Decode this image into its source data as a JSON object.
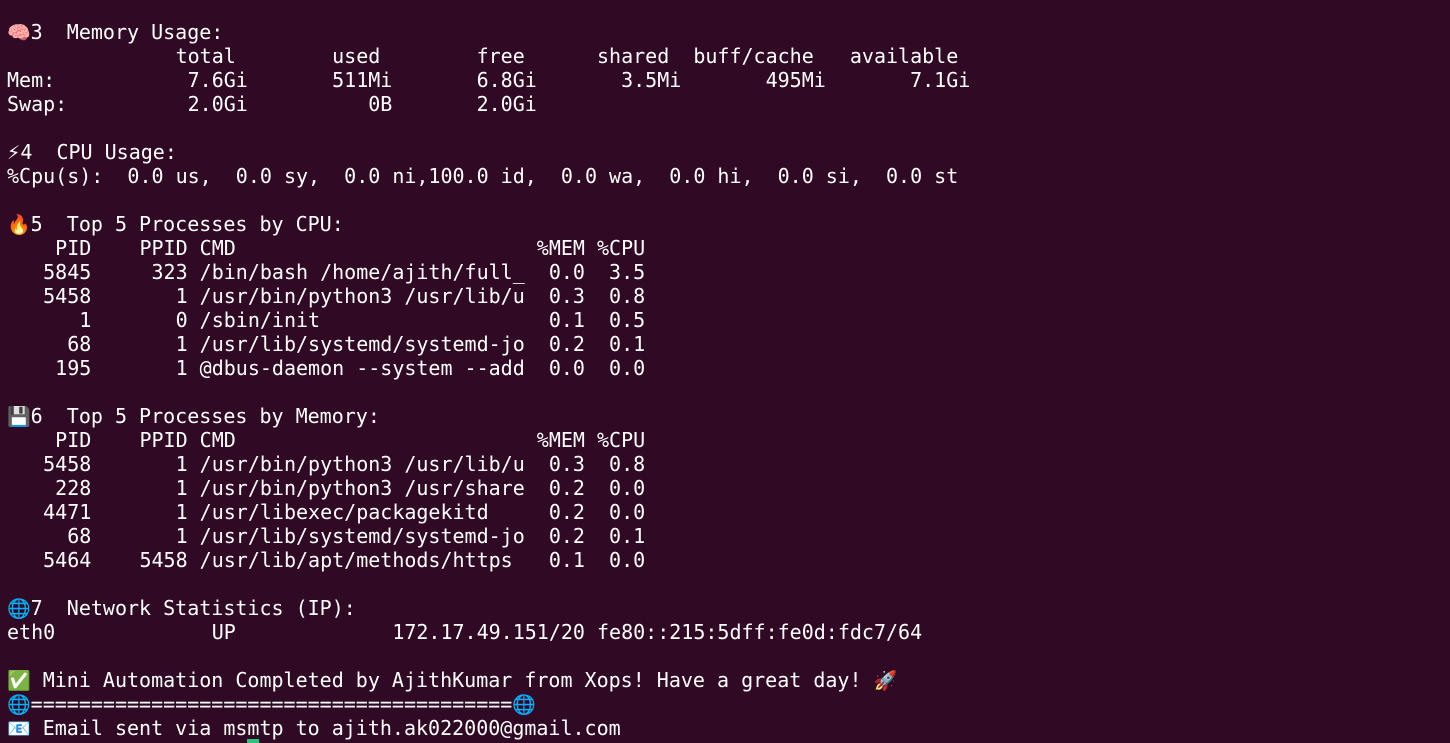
{
  "colors": {
    "background": "#300a24",
    "foreground": "#ffffff",
    "cursor": "#2ec27e"
  },
  "lines": [
    {
      "type": "heading",
      "name": "memory-heading",
      "icon": "brain-icon",
      "glyph": "🧠",
      "text": "3  Memory Usage:"
    },
    {
      "type": "text",
      "name": "memory-table-header",
      "text": "              total        used        free      shared  buff/cache   available"
    },
    {
      "type": "text",
      "name": "memory-row-mem",
      "text": "Mem:           7.6Gi       511Mi       6.8Gi       3.5Mi       495Mi       7.1Gi"
    },
    {
      "type": "text",
      "name": "memory-row-swap",
      "text": "Swap:          2.0Gi          0B       2.0Gi"
    },
    {
      "type": "gap"
    },
    {
      "type": "heading",
      "name": "cpu-heading",
      "icon": "lightning-icon",
      "glyph": "⚡",
      "text": "4  CPU Usage:"
    },
    {
      "type": "text",
      "name": "cpu-usage-line",
      "text": "%Cpu(s):  0.0 us,  0.0 sy,  0.0 ni,100.0 id,  0.0 wa,  0.0 hi,  0.0 si,  0.0 st"
    },
    {
      "type": "gap"
    },
    {
      "type": "heading",
      "name": "top-cpu-heading",
      "icon": "fire-icon",
      "glyph": "🔥",
      "text": "5  Top 5 Processes by CPU:"
    },
    {
      "type": "text",
      "name": "top-cpu-table-header",
      "text": "    PID    PPID CMD                         %MEM %CPU"
    },
    {
      "type": "text",
      "name": "top-cpu-row",
      "text": "   5845     323 /bin/bash /home/ajith/full_  0.0  3.5"
    },
    {
      "type": "text",
      "name": "top-cpu-row",
      "text": "   5458       1 /usr/bin/python3 /usr/lib/u  0.3  0.8"
    },
    {
      "type": "text",
      "name": "top-cpu-row",
      "text": "      1       0 /sbin/init                   0.1  0.5"
    },
    {
      "type": "text",
      "name": "top-cpu-row",
      "text": "     68       1 /usr/lib/systemd/systemd-jo  0.2  0.1"
    },
    {
      "type": "text",
      "name": "top-cpu-row",
      "text": "    195       1 @dbus-daemon --system --add  0.0  0.0"
    },
    {
      "type": "gap"
    },
    {
      "type": "heading",
      "name": "top-mem-heading",
      "icon": "floppy-disk-icon",
      "glyph": "💾",
      "text": "6  Top 5 Processes by Memory:"
    },
    {
      "type": "text",
      "name": "top-mem-table-header",
      "text": "    PID    PPID CMD                         %MEM %CPU"
    },
    {
      "type": "text",
      "name": "top-mem-row",
      "text": "   5458       1 /usr/bin/python3 /usr/lib/u  0.3  0.8"
    },
    {
      "type": "text",
      "name": "top-mem-row",
      "text": "    228       1 /usr/bin/python3 /usr/share  0.2  0.0"
    },
    {
      "type": "text",
      "name": "top-mem-row",
      "text": "   4471       1 /usr/libexec/packagekitd     0.2  0.0"
    },
    {
      "type": "text",
      "name": "top-mem-row",
      "text": "     68       1 /usr/lib/systemd/systemd-jo  0.2  0.1"
    },
    {
      "type": "text",
      "name": "top-mem-row",
      "text": "   5464    5458 /usr/lib/apt/methods/https   0.1  0.0"
    },
    {
      "type": "gap"
    },
    {
      "type": "heading",
      "name": "network-heading",
      "icon": "globe-icon",
      "glyph": "🌐",
      "text": "7  Network Statistics (IP):"
    },
    {
      "type": "text",
      "name": "network-row-eth0",
      "text": "eth0             UP             172.17.49.151/20 fe80::215:5dff:fe0d:fdc7/64"
    },
    {
      "type": "gap"
    },
    {
      "type": "status",
      "name": "completion-message",
      "icon": "check-mark-icon",
      "glyph": "✅",
      "text": " Mini Automation Completed by AjithKumar from Xops! Have a great day! ",
      "trail_icon": "rocket-icon",
      "trail_glyph": "🚀"
    },
    {
      "type": "divider",
      "name": "divider-line",
      "icon": "globe-icon",
      "glyph": "🌐",
      "text": "========================================",
      "trail_icon": "globe-icon",
      "trail_glyph": "🌐"
    },
    {
      "type": "email",
      "name": "email-sent-line",
      "icon": "envelope-icon",
      "glyph": "📧",
      "text": " Email sent via msmtp to ajith.ak022000@gmail.com"
    }
  ]
}
